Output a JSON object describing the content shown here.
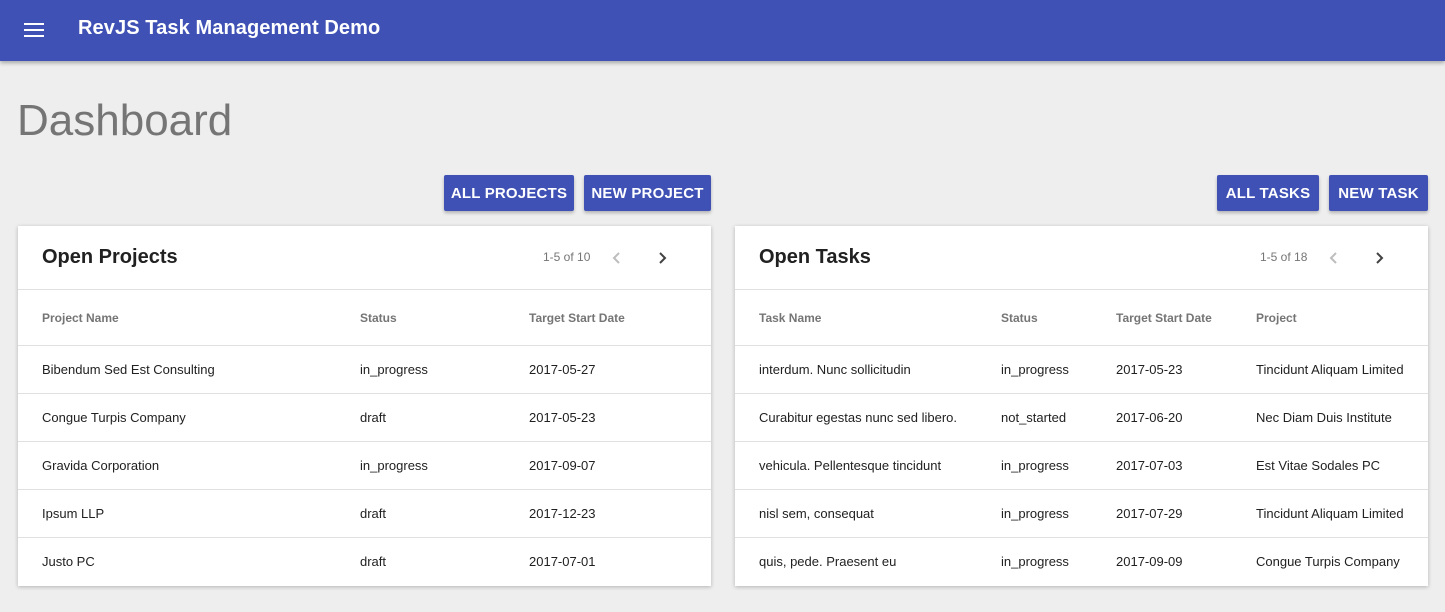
{
  "app": {
    "title": "RevJS Task Management Demo",
    "accent": "#3f51b5"
  },
  "page": {
    "title": "Dashboard"
  },
  "buttons": {
    "all_projects": "ALL PROJECTS",
    "new_project": "NEW PROJECT",
    "all_tasks": "ALL TASKS",
    "new_task": "NEW TASK"
  },
  "projects": {
    "title": "Open Projects",
    "pager": "1-5 of 10",
    "columns": [
      "Project Name",
      "Status",
      "Target Start Date"
    ],
    "rows": [
      [
        "Bibendum Sed Est Consulting",
        "in_progress",
        "2017-05-27"
      ],
      [
        "Congue Turpis Company",
        "draft",
        "2017-05-23"
      ],
      [
        "Gravida Corporation",
        "in_progress",
        "2017-09-07"
      ],
      [
        "Ipsum LLP",
        "draft",
        "2017-12-23"
      ],
      [
        "Justo PC",
        "draft",
        "2017-07-01"
      ]
    ]
  },
  "tasks": {
    "title": "Open Tasks",
    "pager": "1-5 of 18",
    "columns": [
      "Task Name",
      "Status",
      "Target Start Date",
      "Project"
    ],
    "rows": [
      [
        "interdum. Nunc sollicitudin",
        "in_progress",
        "2017-05-23",
        "Tincidunt Aliquam Limited"
      ],
      [
        "Curabitur egestas nunc sed libero.",
        "not_started",
        "2017-06-20",
        "Nec Diam Duis Institute"
      ],
      [
        "vehicula. Pellentesque tincidunt",
        "in_progress",
        "2017-07-03",
        "Est Vitae Sodales PC"
      ],
      [
        "nisl sem, consequat",
        "in_progress",
        "2017-07-29",
        "Tincidunt Aliquam Limited"
      ],
      [
        "quis, pede. Praesent eu",
        "in_progress",
        "2017-09-09",
        "Congue Turpis Company"
      ]
    ]
  },
  "icons": {
    "menu": "menu-icon",
    "prev": "chevron-left-icon",
    "next": "chevron-right-icon"
  }
}
